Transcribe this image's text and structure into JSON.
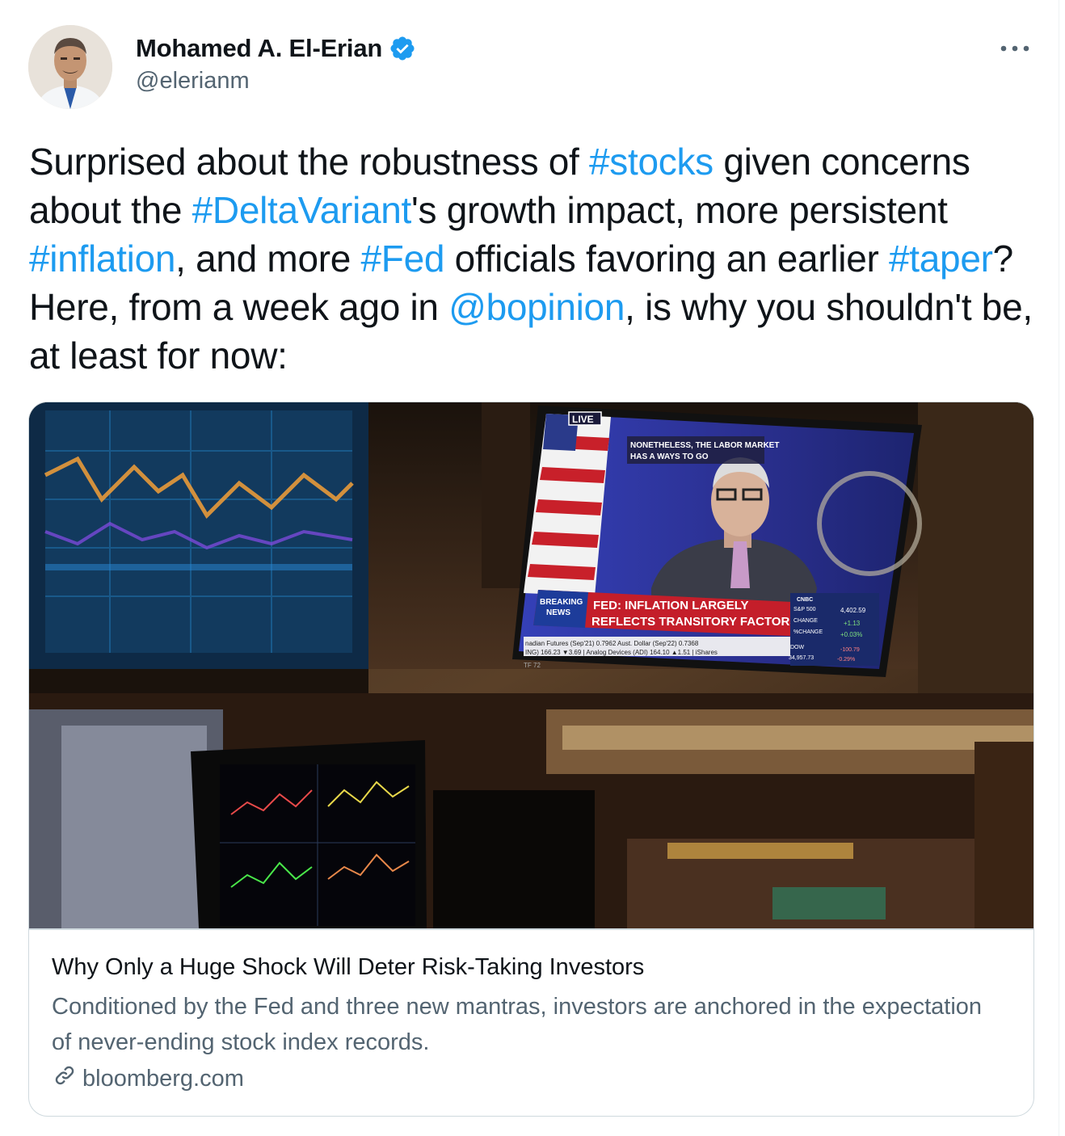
{
  "author": {
    "display_name": "Mohamed A. El-Erian",
    "handle": "@elerianm",
    "verified": true,
    "avatar_icon": "profile-photo"
  },
  "tweet": {
    "segments": [
      {
        "text": "Surprised about the robustness of ",
        "type": "text"
      },
      {
        "text": "#stocks",
        "type": "hashtag"
      },
      {
        "text": " given concerns about the ",
        "type": "text"
      },
      {
        "text": "#DeltaVariant",
        "type": "hashtag"
      },
      {
        "text": "'s growth impact, more persistent ",
        "type": "text"
      },
      {
        "text": "#inflation",
        "type": "hashtag"
      },
      {
        "text": ", and more ",
        "type": "text"
      },
      {
        "text": "#Fed",
        "type": "hashtag"
      },
      {
        "text": " officials favoring an earlier ",
        "type": "text"
      },
      {
        "text": "#taper",
        "type": "hashtag"
      },
      {
        "text": "? Here, from a week ago in ",
        "type": "text"
      },
      {
        "text": "@bopinion",
        "type": "mention"
      },
      {
        "text": ", is why you shouldn't be, at least for now:",
        "type": "text"
      }
    ]
  },
  "card": {
    "image_text": {
      "live": "LIVE",
      "quote_line1": "NONETHELESS, THE LABOR MARKET",
      "quote_line2": "HAS A WAYS TO GO",
      "breaking1": "BREAKING",
      "breaking2": "NEWS",
      "headline1": "FED: INFLATION LARGELY",
      "headline2": "REFLECTS TRANSITORY FACTORS",
      "ticker1": "nadian Futures (Sep'21) 0.7962   Aust. Dollar (Sep'22) 0.7368",
      "ticker2": "ING) 166.23 ▼3.69 | Analog Devices (ADI) 164.10 ▲1.51 | iShares",
      "sp_label": "S&P 500",
      "sp_value": "4,402.59",
      "change_label": "CHANGE",
      "change_value": "+1.13",
      "pct_label": "%CHANGE",
      "pct_value": "+0.03%",
      "dow_label": "DOW",
      "dow_value": "34,957.73",
      "dow_change": "-100.79",
      "dow_pct": "-0.29%",
      "network": "CNBC",
      "tf": "TF 72"
    },
    "title": "Why Only a Huge Shock Will Deter Risk-Taking Investors",
    "description": "Conditioned by the Fed and three new mantras, investors are anchored in the expectation of never-ending stock index records.",
    "domain": "bloomberg.com"
  },
  "colors": {
    "link": "#1d9bf0",
    "secondary": "#536471",
    "border": "#cfd9de"
  }
}
